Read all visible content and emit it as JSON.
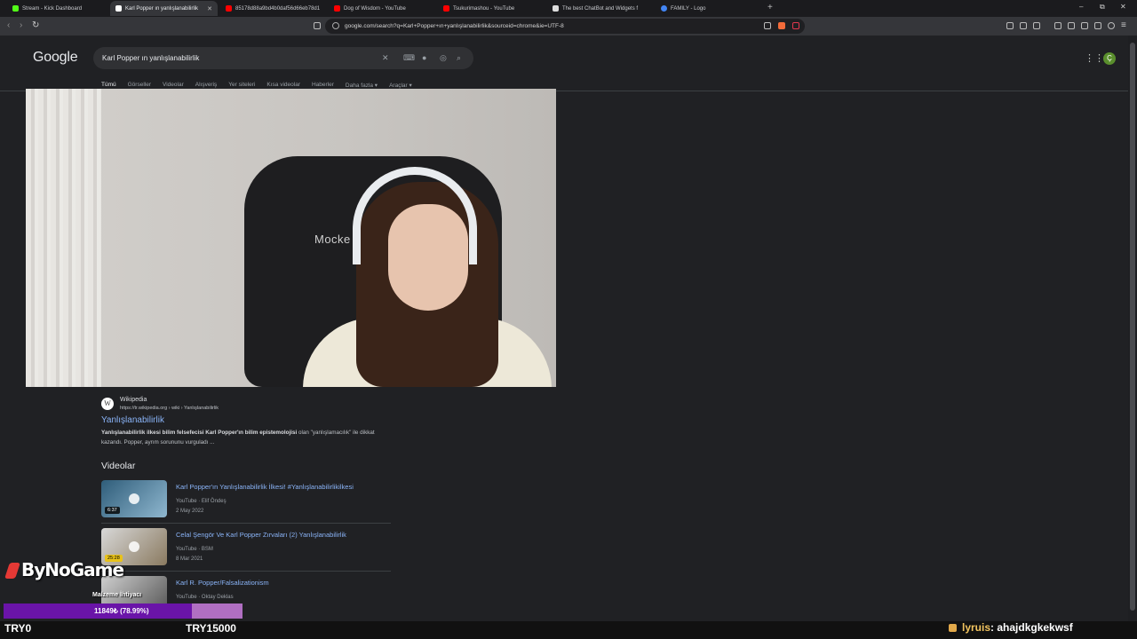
{
  "browser": {
    "tabs": [
      {
        "title": "Stream - Kick Dashboard",
        "active": false,
        "favicon_color": "#53fc18"
      },
      {
        "title": "Karl Popper ın yanlışlanabilirlik",
        "active": true,
        "favicon_color": "#ffffff"
      },
      {
        "title": "85178d88a9bd4b0daf56d66eb78d1",
        "active": false,
        "favicon_color": "#ff0000"
      },
      {
        "title": "Dog of Wisdom - YouTube",
        "active": false,
        "favicon_color": "#ff0000"
      },
      {
        "title": "Tsukurimashou - YouTube",
        "active": false,
        "favicon_color": "#ff0000"
      },
      {
        "title": "The best ChatBot and Widgets f",
        "active": false,
        "favicon_color": "#dddddd"
      },
      {
        "title": "FAMILY - Logo",
        "active": false,
        "favicon_color": "#4285f4"
      }
    ],
    "new_tab": "+",
    "window_controls": {
      "minimize": "–",
      "restore": "⧉",
      "close": "✕"
    },
    "url": "google.com/search?q=Karl+Popper+ın+yanlışlanabilirlik&sourceid=chrome&ie=UTF-8"
  },
  "google": {
    "logo": "Google",
    "query": "Karl Popper ın yanlışlanabilirlik",
    "avatar_letter": "Ç",
    "filters": [
      "Tümü",
      "Görseller",
      "Videolar",
      "Alışveriş",
      "Yer siteleri",
      "Kısa videolar",
      "Haberler",
      "Daha fazla ▾",
      "Araçlar ▾"
    ],
    "result": {
      "favicon_letter": "W",
      "site_name": "Wikipedia",
      "site_url": "https://tr.wikipedia.org › wiki › Yanlışlanabilirlik",
      "title": "Yanlışlanabilirlik",
      "snippet_bold": "Yanlışlanabilirlik ilkesi bilim felsefecisi Karl Popper'ın bilim epistemolojisi",
      "snippet_rest": " olan \"yanlışlamacılık\" ile dikkat kazandı. Popper, ayrım sorununu vurguladı ..."
    },
    "videos_heading": "Videolar",
    "videos": [
      {
        "title": "Karl Popper'ın Yanlışlanabilirlik İlkesi! #Yanlışlanabilirlikilkesi",
        "source": "YouTube · Elif Öndeş",
        "date": "2 May 2022",
        "duration": "6:37"
      },
      {
        "title": "Celal Şengör Ve Karl Popper Zırvaları (2) Yanlışlanabilirlik",
        "source": "YouTube · BSM",
        "date": "8 Mar 2021",
        "duration": "25:28"
      },
      {
        "title": "Karl R. Popper/Falsalizationism",
        "source": "YouTube · Oktay Deklas",
        "date": "",
        "duration": ""
      }
    ]
  },
  "webcam": {
    "chair_text": "Mocke"
  },
  "overlay": {
    "brand": "ByNoGame",
    "sub_label": "Malzeme İhtiyacı",
    "goal_text": "11849₺ (78.99%)",
    "goal_progress": 0.7899,
    "goal_min": "TRY0",
    "goal_max": "TRY15000",
    "chat_user": "lyruis",
    "chat_message": " : ahajdkgkekwsf"
  },
  "colors": {
    "accent_link": "#8ab4f8",
    "goal_fill": "#6a14a8",
    "goal_track": "#b06fc2",
    "page_bg": "#202124"
  }
}
